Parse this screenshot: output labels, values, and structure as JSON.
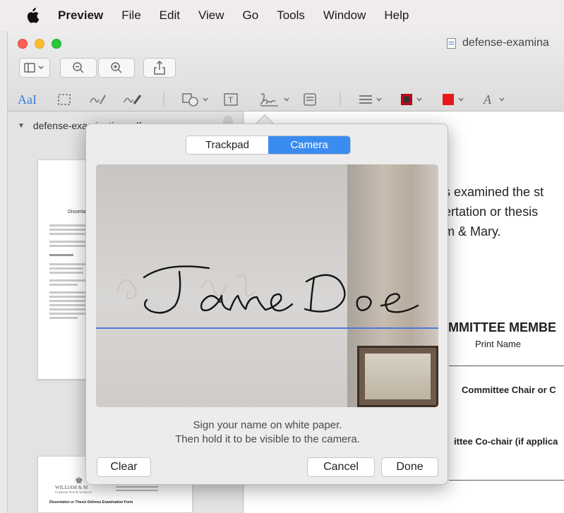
{
  "menubar": {
    "app": "Preview",
    "items": [
      "File",
      "Edit",
      "View",
      "Go",
      "Tools",
      "Window",
      "Help"
    ]
  },
  "window": {
    "title": "defense-examina"
  },
  "markup": {
    "text_tool": "AaI"
  },
  "sidebar": {
    "file_name": "defense-examination.pdf",
    "thumb1_heading": "Dissertati",
    "thumb2_logo_text": "WILLIAM & M",
    "thumb2_school": "Graduate Arts & Sciences",
    "thumb2_form_title": "Dissertation or Thesis Defense Examination Form"
  },
  "document": {
    "line1": "s examined the st",
    "line2": "ertation or thesis",
    "line3": "m & Mary.",
    "committee_heading": "MMITTEE MEMBE",
    "print_name": "Print Name",
    "chair": "Committee Chair or C",
    "cochair": "ittee Co-chair (if applica"
  },
  "signature_popover": {
    "tabs": [
      "Trackpad",
      "Camera"
    ],
    "active_tab": "Camera",
    "signature_text": "Jane Doe",
    "instruction_line1": "Sign your name on white paper.",
    "instruction_line2": "Then hold it to be visible to the camera.",
    "clear_label": "Clear",
    "cancel_label": "Cancel",
    "done_label": "Done"
  },
  "colors": {
    "accent": "#3b8cf0",
    "guide_line": "#4f78d6",
    "border_tool": "#d0021b",
    "fill_tool": "#e8191b"
  }
}
